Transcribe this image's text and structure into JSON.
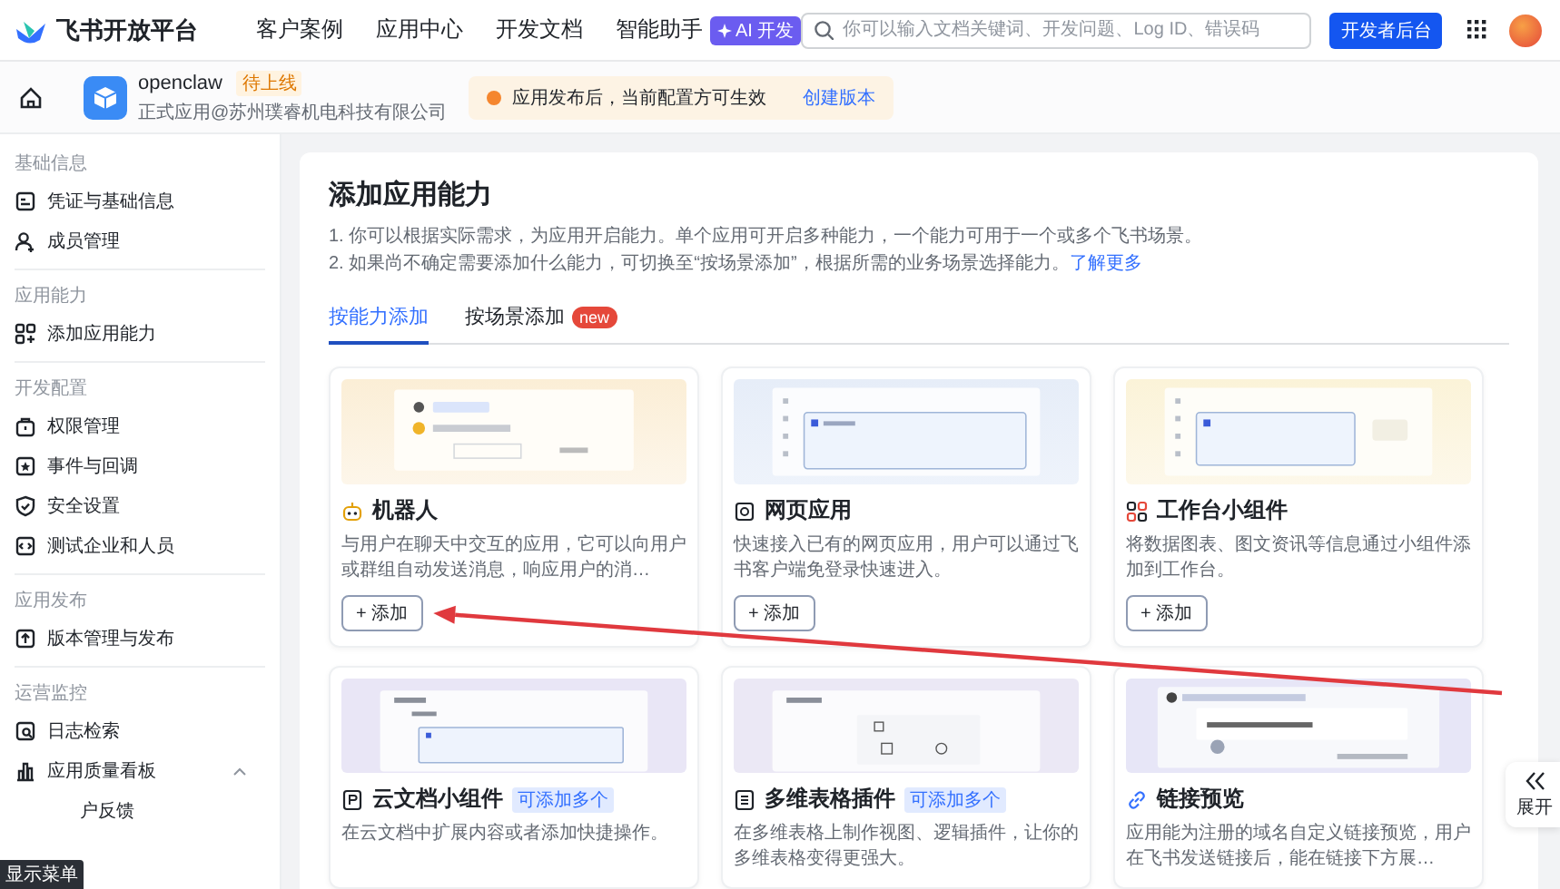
{
  "topbar": {
    "logo_text": "飞书开放平台",
    "nav": [
      {
        "label": "客户案例"
      },
      {
        "label": "应用中心"
      },
      {
        "label": "开发文档"
      },
      {
        "label": "智能助手",
        "badge": "AI 开发"
      }
    ],
    "search": {
      "placeholder": "你可以输入文档关键词、开发问题、Log ID、错误码"
    },
    "console_button": "开发者后台"
  },
  "app_bar": {
    "app_name": "openclaw",
    "status": "待上线",
    "subtitle": "正式应用@苏州璞睿机电科技有限公司",
    "notice": {
      "text": "应用发布后，当前配置方可生效",
      "link": "创建版本"
    }
  },
  "sidebar": {
    "groups": [
      {
        "title": "基础信息",
        "items": [
          {
            "label": "凭证与基础信息"
          },
          {
            "label": "成员管理"
          }
        ]
      },
      {
        "title": "应用能力",
        "items": [
          {
            "label": "添加应用能力"
          }
        ]
      },
      {
        "title": "开发配置",
        "items": [
          {
            "label": "权限管理"
          },
          {
            "label": "事件与回调"
          },
          {
            "label": "安全设置"
          },
          {
            "label": "测试企业和人员"
          }
        ]
      },
      {
        "title": "应用发布",
        "items": [
          {
            "label": "版本管理与发布"
          }
        ]
      },
      {
        "title": "运营监控",
        "items": [
          {
            "label": "日志检索"
          },
          {
            "label": "应用质量看板",
            "expanded": true,
            "children": [
              {
                "label": "户反馈"
              }
            ]
          }
        ]
      }
    ]
  },
  "content": {
    "title": "添加应用能力",
    "notes": [
      "1. 你可以根据实际需求，为应用开启能力。单个应用可开启多种能力，一个能力可用于一个或多个飞书场景。",
      "2. 如果尚不确定需要添加什么能力，可切换至“按场景添加”，根据所需的业务场景选择能力。"
    ],
    "notes_link": "了解更多",
    "tabs": [
      {
        "label": "按能力添加",
        "selected": true
      },
      {
        "label": "按场景添加",
        "selected": false,
        "badge": "new"
      }
    ],
    "cards": [
      {
        "title": "机器人",
        "description": "与用户在聊天中交互的应用，它可以向用户或群组自动发送消息，响应用户的消…",
        "button": "+ 添加"
      },
      {
        "title": "网页应用",
        "description": "快速接入已有的网页应用，用户可以通过飞书客户端免登录快速进入。",
        "button": "+ 添加"
      },
      {
        "title": "工作台小组件",
        "description": "将数据图表、图文资讯等信息通过小组件添加到工作台。",
        "button": "+ 添加"
      },
      {
        "title": "云文档小组件",
        "tag": "可添加多个",
        "description": "在云文档中扩展内容或者添加快捷操作。"
      },
      {
        "title": "多维表格插件",
        "tag": "可添加多个",
        "description": "在多维表格上制作视图、逻辑插件，让你的多维表格变得更强大。"
      },
      {
        "title": "链接预览",
        "description": "应用能为注册的域名自定义链接预览，用户在飞书发送链接后，能在链接下方展…"
      }
    ]
  },
  "side_handle": "展开",
  "tooltip": "显示菜单"
}
